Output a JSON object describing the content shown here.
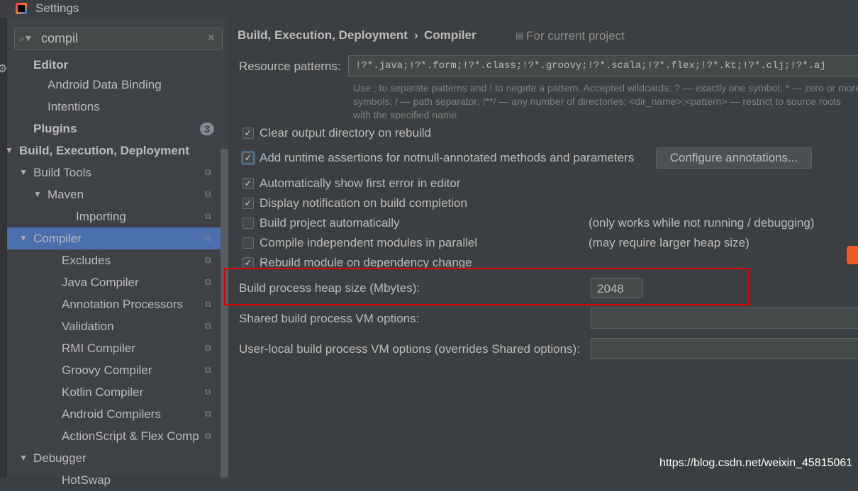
{
  "window": {
    "title": "Settings"
  },
  "search": {
    "value": "compil"
  },
  "sidebar": {
    "items": [
      {
        "label": "Editor",
        "bold": true
      },
      {
        "label": "Android Data Binding"
      },
      {
        "label": "Intentions"
      },
      {
        "label": "Plugins",
        "bold": true,
        "badge": "3"
      },
      {
        "label": "Build, Execution, Deployment",
        "bold": true,
        "expanded": true
      },
      {
        "label": "Build Tools",
        "expanded": true
      },
      {
        "label": "Maven",
        "expanded": true
      },
      {
        "label": "Importing"
      },
      {
        "label": "Compiler",
        "expanded": true,
        "selected": true
      },
      {
        "label": "Excludes"
      },
      {
        "label": "Java Compiler"
      },
      {
        "label": "Annotation Processors"
      },
      {
        "label": "Validation"
      },
      {
        "label": "RMI Compiler"
      },
      {
        "label": "Groovy Compiler"
      },
      {
        "label": "Kotlin Compiler"
      },
      {
        "label": "Android Compilers"
      },
      {
        "label": "ActionScript & Flex Comp"
      },
      {
        "label": "Debugger",
        "expanded": true
      },
      {
        "label": "HotSwap"
      }
    ]
  },
  "header": {
    "breadcrumb_parent": "Build, Execution, Deployment",
    "separator": "›",
    "breadcrumb_current": "Compiler",
    "scope": "For current project"
  },
  "resource": {
    "label": "Resource patterns:",
    "value": "!?*.java;!?*.form;!?*.class;!?*.groovy;!?*.scala;!?*.flex;!?*.kt;!?*.clj;!?*.aj",
    "help1": "Use ; to separate patterns and ! to negate a pattern. Accepted wildcards: ? — exactly one symbol; * — zero or more",
    "help2": "symbols; / — path separator; /**/ — any number of directories; <dir_name>:<pattern> — restrict to source roots",
    "help3": "with the specified name"
  },
  "options": [
    {
      "label": "Clear output directory on rebuild",
      "checked": true
    },
    {
      "label": "Add runtime assertions for notnull-annotated methods and parameters",
      "checked": true
    },
    {
      "label": "Automatically show first error in editor",
      "checked": true
    },
    {
      "label": "Display notification on build completion",
      "checked": true
    },
    {
      "label": "Build project automatically",
      "checked": false,
      "note": "(only works while not running / debugging)"
    },
    {
      "label": "Compile independent modules in parallel",
      "checked": false,
      "note": "(may require larger heap size)"
    },
    {
      "label": "Rebuild module on dependency change",
      "checked": true
    }
  ],
  "configure_button": "Configure annotations...",
  "heap": {
    "label": "Build process heap size (Mbytes):",
    "value": "2048"
  },
  "shared_vm": {
    "label": "Shared build process VM options:",
    "value": ""
  },
  "user_vm": {
    "label": "User-local build process VM options (overrides Shared options):",
    "value": ""
  },
  "watermark": "https://blog.csdn.net/weixin_45815061",
  "colors": {
    "background": "#3c3f41",
    "selection": "#4b6eaf",
    "highlight_box": "#e00000"
  }
}
